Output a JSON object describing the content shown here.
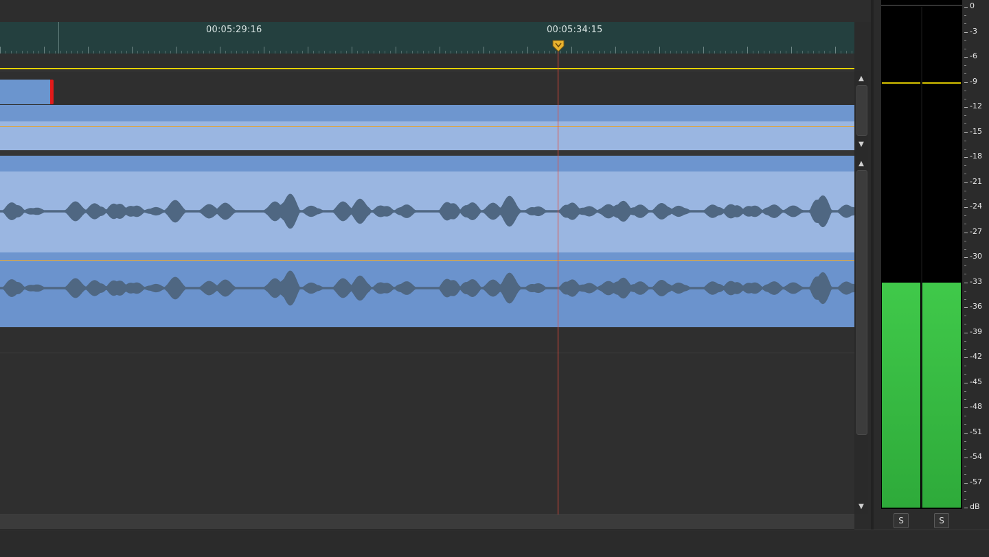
{
  "ruler": {
    "timecodes": [
      {
        "label": "00:05:29:16"
      },
      {
        "label": "00:05:34:15"
      }
    ]
  },
  "playhead": {
    "timecode": "00:05:34:15"
  },
  "meter": {
    "scale_labels": [
      "0",
      "-3",
      "-6",
      "-9",
      "-12",
      "-15",
      "-18",
      "-21",
      "-24",
      "-27",
      "-30",
      "-33",
      "-36",
      "-39",
      "-42",
      "-45",
      "-48",
      "-51",
      "-54",
      "-57",
      "dB"
    ],
    "channels": [
      {
        "name": "left",
        "level_db": -33,
        "peak_db": -9
      },
      {
        "name": "right",
        "level_db": -33,
        "peak_db": -9
      }
    ],
    "solo_buttons": [
      "S",
      "S"
    ]
  },
  "colors": {
    "ruler_bg": "#24403f",
    "clip_light": "#9ab6e1",
    "clip_dark": "#6d95cf",
    "playhead": "#e84a3a",
    "meter_green": "#3cc24a",
    "loop_yellow": "#e5d200"
  },
  "icons": {
    "scroll_up": "▲",
    "scroll_down": "▼"
  }
}
